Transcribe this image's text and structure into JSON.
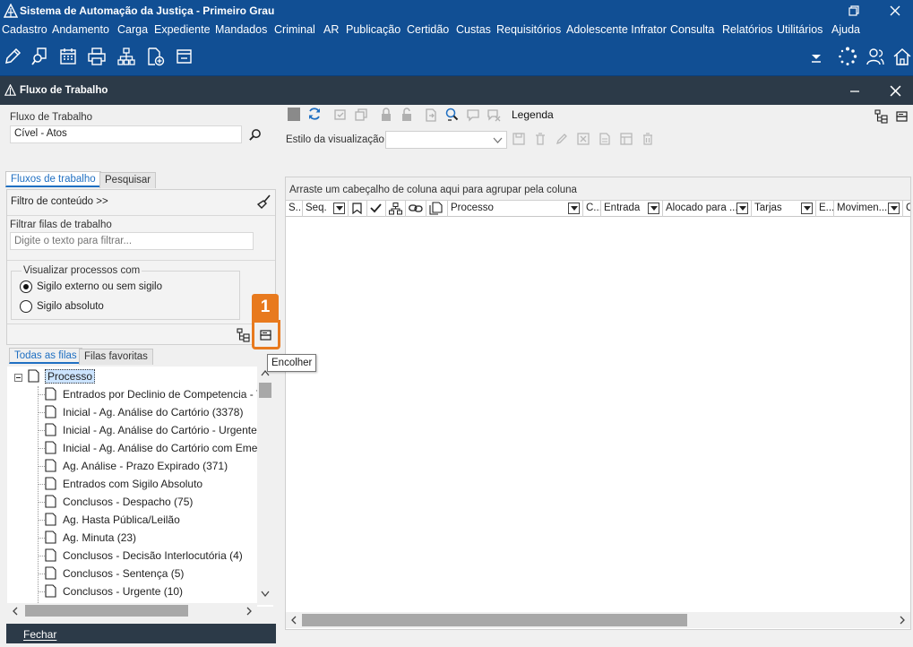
{
  "window": {
    "title": "Sistema de Automação da Justiça - Primeiro Grau"
  },
  "menu": [
    "Cadastro",
    "Andamento",
    "Carga",
    "Expediente",
    "Mandados",
    "Criminal",
    "AR",
    "Publicação",
    "Certidão",
    "Custas",
    "Requisitórios",
    "Adolescente Infrator",
    "Consulta",
    "Relatórios",
    "Utilitários",
    "Ajuda"
  ],
  "panel": {
    "title": "Fluxo de Trabalho"
  },
  "left": {
    "fluxo_label": "Fluxo de Trabalho",
    "fluxo_value": "Cível - Atos",
    "tabs": [
      "Fluxos de trabalho",
      "Pesquisar"
    ],
    "filtro_conteudo": "Filtro de conteúdo >>",
    "filtrar_label": "Filtrar filas de trabalho",
    "filtrar_placeholder": "Digite o texto para filtrar...",
    "visualizar_label": "Visualizar processos com",
    "radio_externo": "Sigilo externo ou sem sigilo",
    "radio_absoluto": "Sigilo absoluto",
    "queue_tabs": [
      "Todas as filas",
      "Filas favoritas"
    ],
    "tree_root": "Processo",
    "queues": [
      "Entrados por Declinio de Competencia - T",
      "Inicial - Ag. Análise do Cartório (3378)",
      "Inicial - Ag. Análise do Cartório - Urgente",
      "Inicial - Ag. Análise do Cartório com Emer",
      "Ag. Análise - Prazo Expirado (371)",
      "Entrados com Sigilo Absoluto",
      "Conclusos - Despacho (75)",
      "Ag. Hasta Pública/Leilão",
      "Ag. Minuta (23)",
      "Conclusos - Decisão Interlocutória (4)",
      "Conclusos - Sentença (5)",
      "Conclusos - Urgente (10)"
    ],
    "fechar": "Fechar"
  },
  "right": {
    "legenda": "Legenda",
    "estilo_label": "Estilo da visualização",
    "group_hint": "Arraste um cabeçalho de coluna aqui para agrupar pela coluna",
    "columns": [
      "S...",
      "Seq.",
      "",
      "",
      "",
      "",
      "",
      "Processo",
      "C...",
      "Entrada",
      "Alocado para ...",
      "Tarjas",
      "E...",
      "Movimen...",
      "C"
    ]
  },
  "callout": {
    "number": "1",
    "tooltip": "Encolher"
  }
}
